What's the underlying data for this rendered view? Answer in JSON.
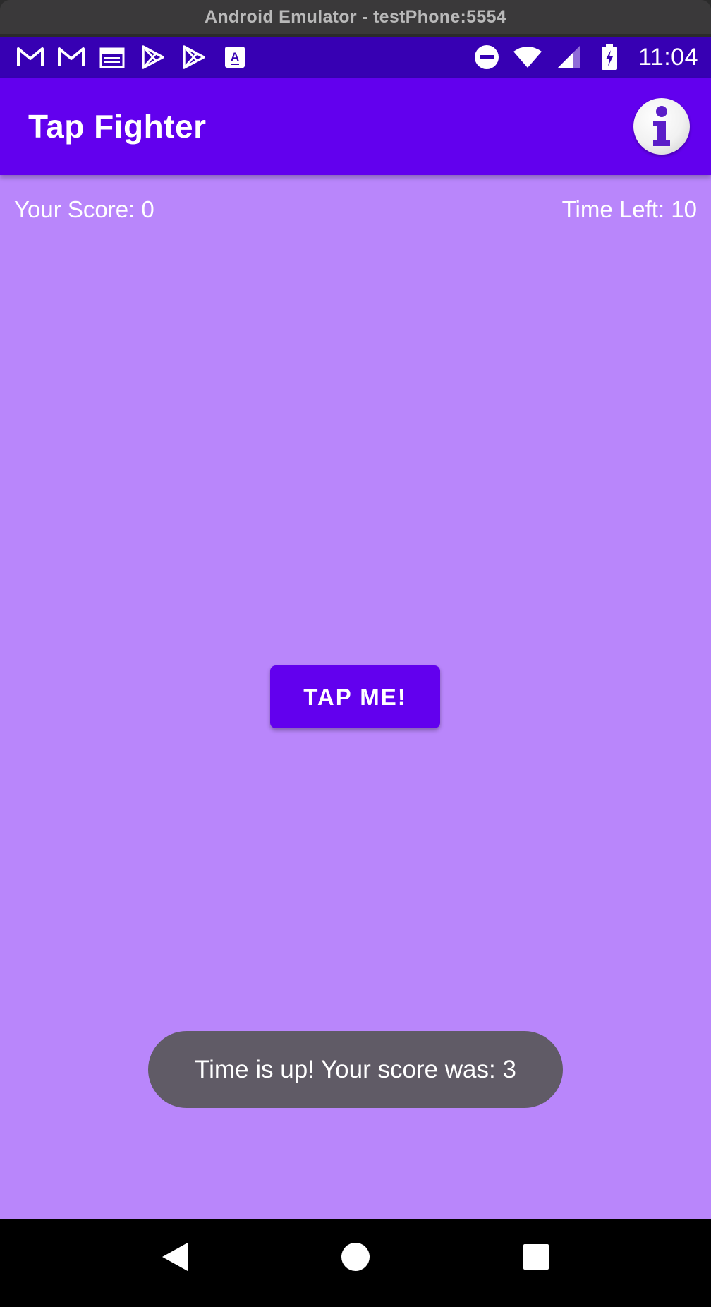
{
  "window": {
    "title": "Android Emulator - testPhone:5554"
  },
  "status_bar": {
    "left_icons": [
      "gmail-icon",
      "gmail-icon",
      "calendar-icon",
      "play-store-icon",
      "play-store-icon",
      "a-icon"
    ],
    "right_icons": [
      "do-not-disturb-icon",
      "wifi-icon",
      "signal-icon",
      "battery-charging-icon"
    ],
    "time": "11:04"
  },
  "app_bar": {
    "title": "Tap Fighter",
    "info_icon": "info-icon"
  },
  "game": {
    "score_label": "Your Score: 0",
    "time_label": "Time Left: 10",
    "tap_button": "TAP ME!"
  },
  "toast": {
    "message": "Time is up! Your score was: 3"
  },
  "nav_bar": {
    "icons": [
      "back-icon",
      "home-icon",
      "recents-icon"
    ]
  },
  "colors": {
    "status_bar": "#3700b3",
    "app_bar": "#6200ee",
    "background": "#b986fb",
    "button": "#6200ee",
    "toast": "#605b66"
  }
}
